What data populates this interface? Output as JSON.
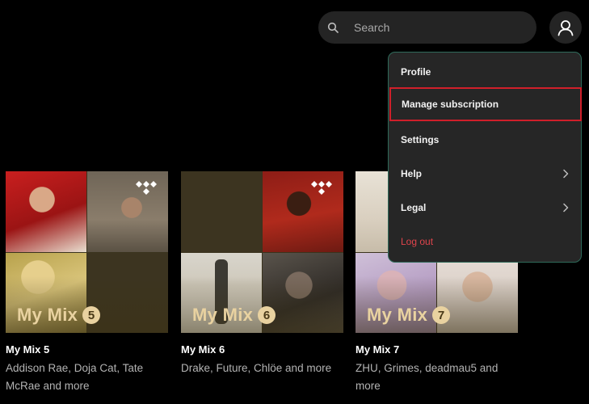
{
  "search": {
    "placeholder": "Search",
    "icon": "search-icon"
  },
  "profile": {
    "icon": "user-icon"
  },
  "menu": {
    "items": [
      {
        "label": "Profile"
      },
      {
        "label": "Manage subscription",
        "highlighted": true
      },
      {
        "label": "Settings"
      },
      {
        "label": "Help",
        "has_submenu": true
      },
      {
        "label": "Legal",
        "has_submenu": true
      },
      {
        "label": "Log out",
        "color": "#e0444c"
      }
    ]
  },
  "mixes": [
    {
      "cover_label": "My Mix",
      "number": "5",
      "title": "My Mix 5",
      "subtitle": "Addison Rae, Doja Cat, Tate McRae and more"
    },
    {
      "cover_label": "My Mix",
      "number": "6",
      "title": "My Mix 6",
      "subtitle": "Drake, Future, Chlöe and more"
    },
    {
      "cover_label": "My Mix",
      "number": "7",
      "title": "My Mix 7",
      "subtitle": "ZHU, Grimes, deadmau5 and more"
    }
  ],
  "colors": {
    "background": "#000000",
    "accent_highlight": "#d01f2a",
    "mix_label": "#e9d2a0",
    "logout": "#e0444c"
  }
}
